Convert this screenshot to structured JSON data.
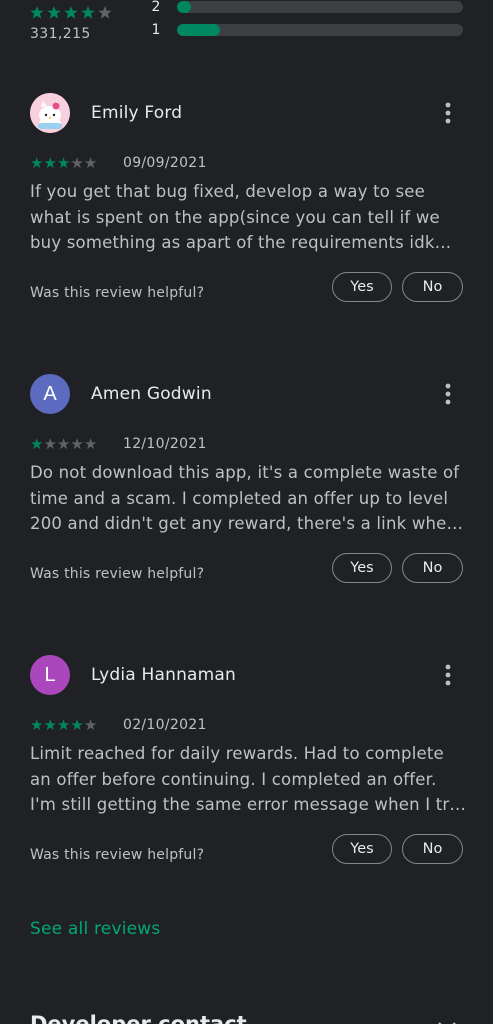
{
  "ratings_summary": {
    "stars_display": "★★★★★",
    "total_count": "331,215",
    "bars": [
      {
        "label": "2",
        "fraction": 0.05
      },
      {
        "label": "1",
        "fraction": 0.15
      }
    ]
  },
  "reviews": [
    {
      "name": "Emily Ford",
      "avatar_type": "image",
      "avatar_letter": "",
      "avatar_color": "#f6c6d6",
      "rating": 3,
      "date": "09/09/2021",
      "text": "If you get that bug fixed, develop a way to see what is spent on the app(since you can tell if we buy something as apart of the requirements idk why thi…",
      "helpful_prompt": "Was this review helpful?",
      "yes_label": "Yes",
      "no_label": "No"
    },
    {
      "name": "Amen Godwin",
      "avatar_type": "letter",
      "avatar_letter": "A",
      "avatar_color": "#5c6bc0",
      "rating": 1,
      "date": "12/10/2021",
      "text": "Do not download this app, it's a complete waste of time and a scam. I completed an offer up to level 200 and didn't get any reward, there's a link where it…",
      "helpful_prompt": "Was this review helpful?",
      "yes_label": "Yes",
      "no_label": "No"
    },
    {
      "name": "Lydia Hannaman",
      "avatar_type": "letter",
      "avatar_letter": "L",
      "avatar_color": "#ab47bc",
      "rating": 4,
      "date": "02/10/2021",
      "text": "Limit reached for daily rewards. Had to complete an offer before continuing. I completed an offer. I'm still getting the same error message when I try to click …",
      "helpful_prompt": "Was this review helpful?",
      "yes_label": "Yes",
      "no_label": "No"
    }
  ],
  "see_all_label": "See all reviews",
  "developer_contact_label": "Developer contact",
  "colors": {
    "accent": "#01875f",
    "link": "#01a971",
    "background": "#202124"
  },
  "icons": {
    "more": "more-vert-icon",
    "chevron": "chevron-down-icon"
  }
}
